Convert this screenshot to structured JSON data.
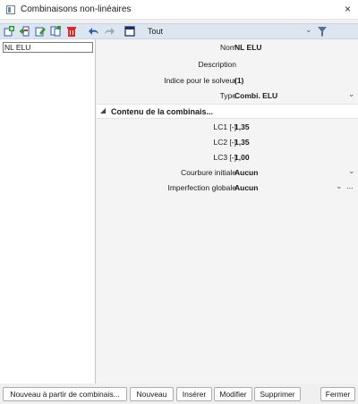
{
  "window": {
    "title": "Combinaisons non-linéaires",
    "close_glyph": "×"
  },
  "toolbar": {
    "icons": [
      "new-icon",
      "insert-icon",
      "edit-icon",
      "copy-icon",
      "delete-icon",
      "undo-icon",
      "redo-icon",
      "table-icon"
    ],
    "filter_value": "Tout",
    "filter_icon": "funnel-icon"
  },
  "list": {
    "items": [
      {
        "label": "NL ELU"
      }
    ]
  },
  "properties": {
    "name": {
      "label": "Nom",
      "value": "NL ELU"
    },
    "description": {
      "label": "Description",
      "value": ""
    },
    "solver_index": {
      "label": "Indice pour le solveur",
      "value": "(1)"
    },
    "type": {
      "label": "Type",
      "value": "Combi. ELU"
    },
    "section_title": "Contenu de la combinais...",
    "lc1": {
      "label": "LC1 [-]",
      "value": "1,35"
    },
    "lc2": {
      "label": "LC2 [-]",
      "value": "1,35"
    },
    "lc3": {
      "label": "LC3 [-]",
      "value": "1,00"
    },
    "curvature": {
      "label": "Courbure initiale",
      "value": "Aucun"
    },
    "imperfection": {
      "label": "Imperfection globale",
      "value": "Aucun",
      "more": "..."
    }
  },
  "buttons": {
    "new_from": "Nouveau à partir de combinais...",
    "new": "Nouveau",
    "insert": "Insérer",
    "modify": "Modifier",
    "delete": "Supprimer",
    "close": "Fermer"
  },
  "colors": {
    "toolbar_bg": "#dde6f0",
    "accent_green": "#2e9a3a",
    "accent_red": "#d92b2b",
    "accent_blue": "#2b5aa6"
  }
}
